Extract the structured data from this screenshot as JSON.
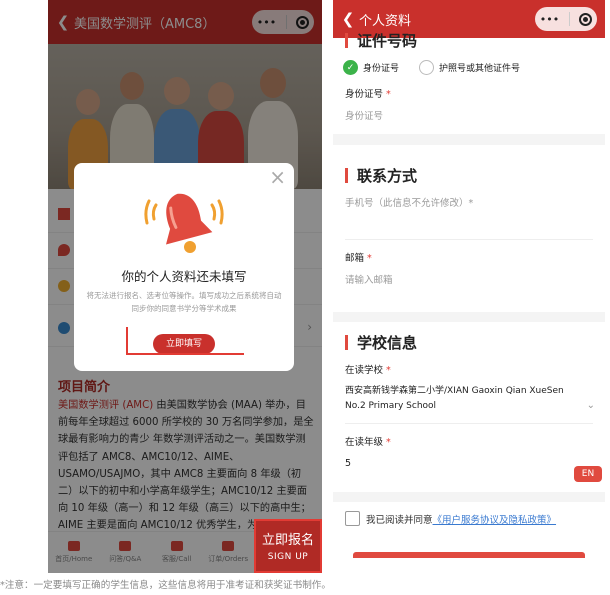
{
  "left": {
    "nav_title": "美国数学测评（AMC8）",
    "back_icon": "chevron-left-icon",
    "capsule_more": "•••",
    "section_title": "项目简介",
    "intro": {
      "highlight": "美国数学测评 (AMC)",
      "rest": " 由美国数学协会 (MAA) 举办，目前每年全球超过 6000 所学校的 30 万名同学参加，是全球最有影响力的青少 年数学测评活动之一。美国数学测评包括了 AMC8、AMC10/12、AIME、USAMO/USAJMO，其中 AMC8 主要面向 8 年级（初 二）以下的初中和小学高年级学生；AMC10/12 主要面向 10 年级（高一）和 12 年级（高三）以下的高中生；AIME 主要是面向 AMC10/12 优秀学生，为美国数学奥林匹克USAMO/USAJMO 和美国数学奥林匹克国家队的选拔。"
    },
    "tabs": [
      {
        "label": "首页/Home",
        "icon": "home-icon"
      },
      {
        "label": "问答/Q&A",
        "icon": "chat-icon"
      },
      {
        "label": "客服/Call",
        "icon": "phone-icon"
      },
      {
        "label": "订单/Orders",
        "icon": "orders-icon"
      }
    ],
    "signup": {
      "label_cn": "立即报名",
      "label_en": "SIGN UP"
    },
    "modal": {
      "title": "你的个人资料还未填写",
      "desc": "将无法进行报名、选考位等操作。填写成功之后系统将自动同步你的同意书学分等学术成果",
      "button": "立即填写",
      "close": "×"
    }
  },
  "right": {
    "nav_title": "个人资料",
    "capsule_more": "•••",
    "id_section": {
      "title": "证件号码",
      "option_id": "身份证号",
      "option_passport": "护照号或其他证件号",
      "selected": "身份证号",
      "field_label": "身份证号",
      "field_placeholder": "身份证号"
    },
    "contact": {
      "title": "联系方式",
      "phone_label": "手机号（此信息不允许修改）",
      "email_label": "邮箱",
      "email_placeholder": "请输入邮箱"
    },
    "school": {
      "title": "学校信息",
      "school_label": "在读学校",
      "school_value_line1": "西安高新钱学森第二小学/XIAN Gaoxin Qian XueSen",
      "school_value_line2": "No.2 Primary School",
      "grade_label": "在读年级",
      "grade_value": "5"
    },
    "en_tag": "EN",
    "agreement": {
      "prefix": "我已阅读并同意",
      "link": "《用户服务协议及隐私政策》"
    },
    "required_mark": "*"
  },
  "caption": "*注意：一定要填写正确的学生信息，这些信息将用于准考证和获奖证书制作。",
  "colors": {
    "brand_red": "#c9302c",
    "check_green": "#3cb34a"
  }
}
